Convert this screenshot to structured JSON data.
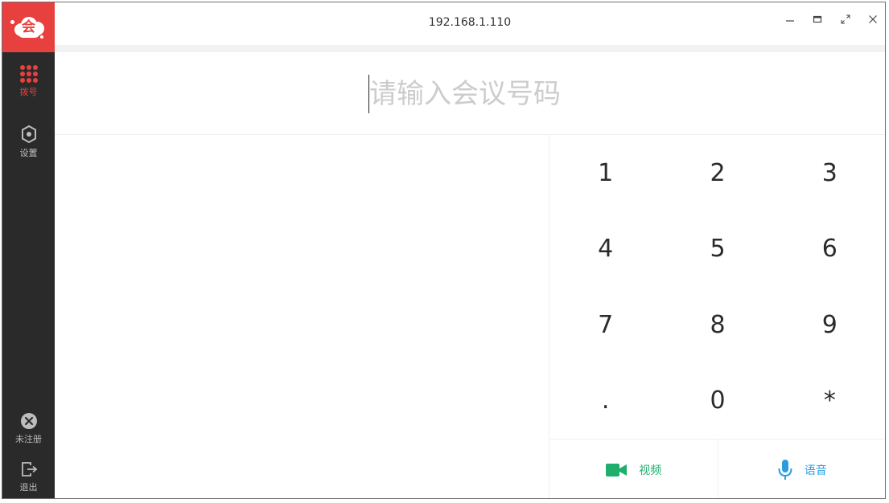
{
  "app": {
    "logo_glyph": "会",
    "brand_color": "#e8403f"
  },
  "titlebar": {
    "address": "192.168.1.110",
    "controls": [
      "minimize-icon",
      "restore-icon",
      "fullscreen-icon",
      "close-icon"
    ]
  },
  "sidebar": {
    "items": [
      {
        "label": "拨号",
        "icon": "dialpad-icon",
        "active": true
      },
      {
        "label": "设置",
        "icon": "settings-icon",
        "active": false
      }
    ],
    "bottom": [
      {
        "label": "未注册",
        "icon": "unregistered-icon"
      },
      {
        "label": "退出",
        "icon": "exit-icon"
      }
    ]
  },
  "dial": {
    "placeholder": "请输入会议号码",
    "value": ""
  },
  "keypad": {
    "keys": [
      "1",
      "2",
      "3",
      "4",
      "5",
      "6",
      "7",
      "8",
      "9",
      ".",
      "0",
      "*"
    ]
  },
  "actions": {
    "video_label": "视频",
    "voice_label": "语音",
    "video_color": "#1fae6c",
    "voice_color": "#2a9de0"
  }
}
